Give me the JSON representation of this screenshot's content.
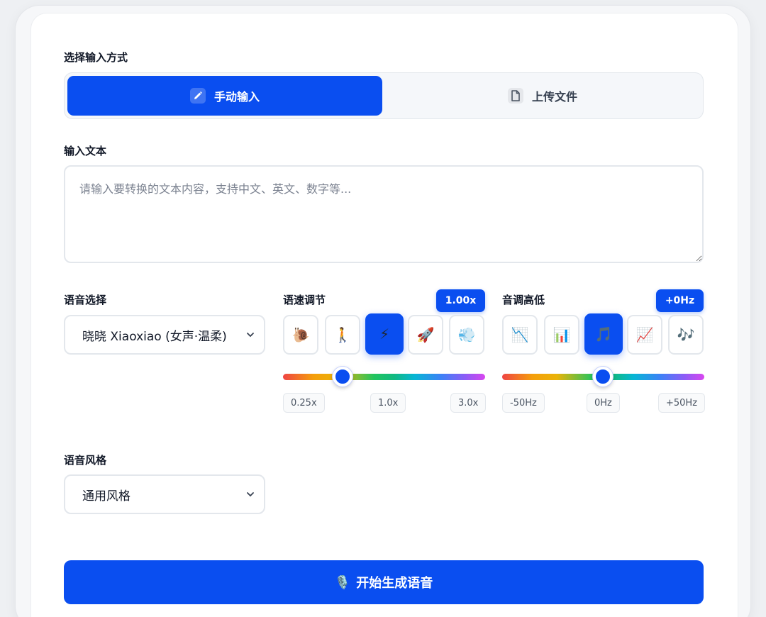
{
  "input_mode": {
    "label": "选择输入方式",
    "manual": {
      "label": "手动输入",
      "icon": "pencil-icon"
    },
    "upload": {
      "label": "上传文件",
      "icon": "file-icon"
    },
    "selected": "manual"
  },
  "text_input": {
    "label": "输入文本",
    "placeholder": "请输入要转换的文本内容，支持中文、英文、数字等...",
    "value": ""
  },
  "voice": {
    "label": "语音选择",
    "selected": "晓晓 Xiaoxiao (女声·温柔)"
  },
  "speed": {
    "label": "语速调节",
    "value_display": "1.00x",
    "value": 1.0,
    "min": 0.25,
    "max": 3.0,
    "presets": [
      {
        "emoji": "🐌",
        "name": "snail-icon"
      },
      {
        "emoji": "🚶",
        "name": "walking-icon"
      },
      {
        "emoji": "⚡",
        "name": "lightning-icon"
      },
      {
        "emoji": "🚀",
        "name": "rocket-icon"
      },
      {
        "emoji": "💨",
        "name": "wind-icon"
      }
    ],
    "selected_preset": 2,
    "ticks": [
      "0.25x",
      "1.0x",
      "3.0x"
    ]
  },
  "pitch": {
    "label": "音调高低",
    "value_display": "+0Hz",
    "value": 0,
    "min": -50,
    "max": 50,
    "presets": [
      {
        "emoji": "📉",
        "name": "chart-down-icon"
      },
      {
        "emoji": "📊",
        "name": "bar-chart-icon"
      },
      {
        "emoji": "🎵",
        "name": "music-note-icon"
      },
      {
        "emoji": "📈",
        "name": "chart-up-icon"
      },
      {
        "emoji": "🎶",
        "name": "music-notes-icon"
      }
    ],
    "selected_preset": 2,
    "ticks": [
      "-50Hz",
      "0Hz",
      "+50Hz"
    ]
  },
  "style": {
    "label": "语音风格",
    "selected": "通用风格"
  },
  "generate": {
    "label": "开始生成语音",
    "icon": "🎙️"
  },
  "colors": {
    "accent": "#0a4ef0",
    "border": "#e3e7ec"
  }
}
